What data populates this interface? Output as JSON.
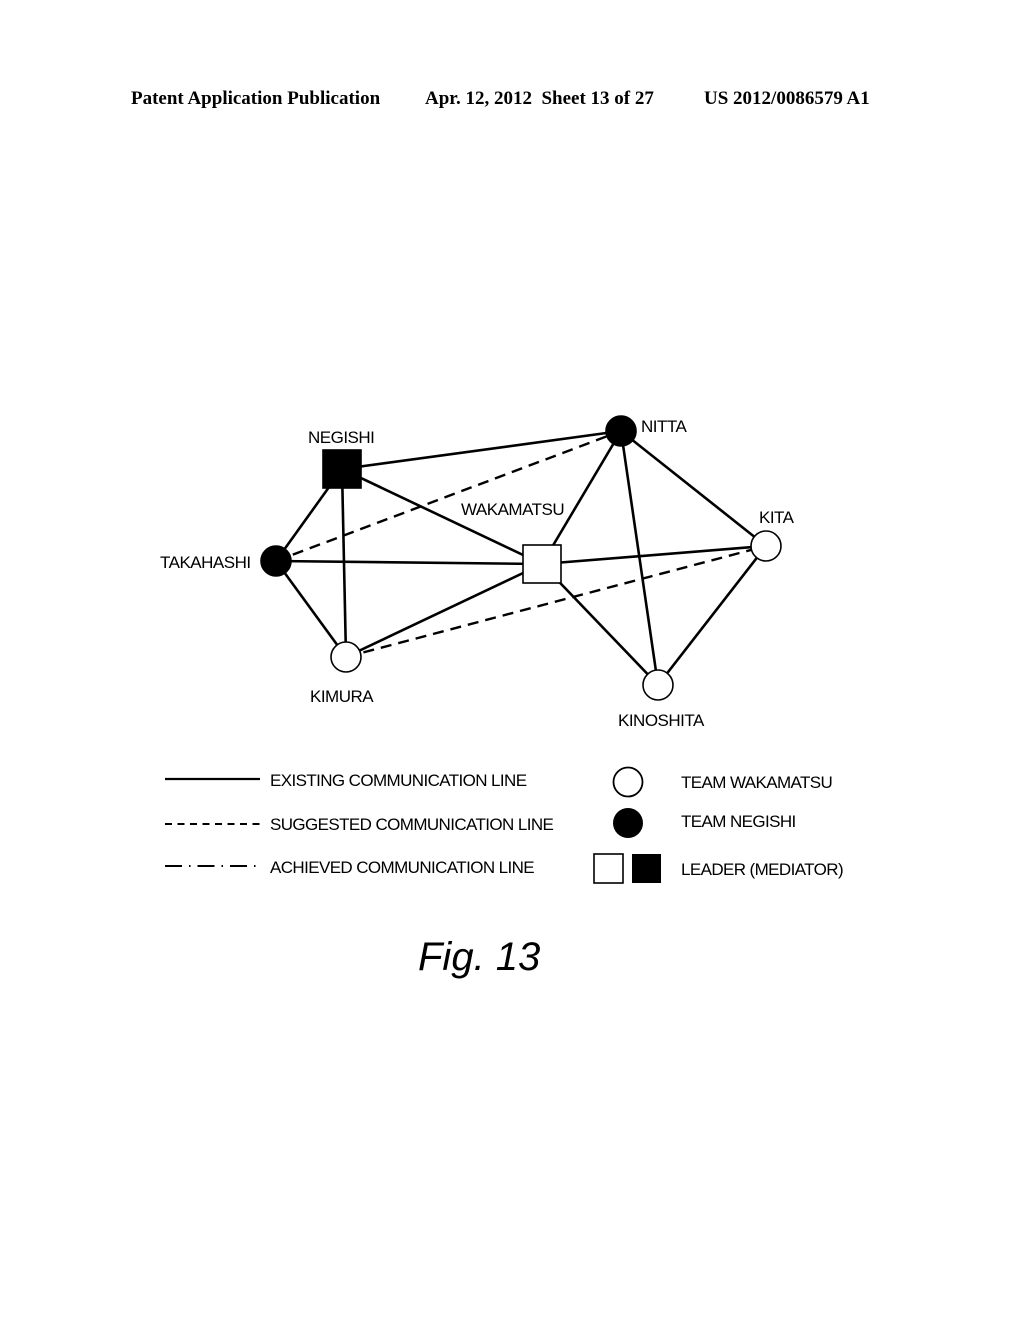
{
  "header": {
    "publication": "Patent Application Publication",
    "date_sheet": "Apr. 12, 2012  Sheet 13 of 27",
    "patent_number": "US 2012/0086579 A1"
  },
  "figure": {
    "caption": "Fig. 13",
    "nodes": [
      {
        "id": "negishi",
        "label": "NEGISHI",
        "team": "negishi",
        "leader": true
      },
      {
        "id": "takahashi",
        "label": "TAKAHASHI",
        "team": "negishi",
        "leader": false
      },
      {
        "id": "kimura",
        "label": "KIMURA",
        "team": "wakamatsu",
        "leader": false
      },
      {
        "id": "wakamatsu",
        "label": "WAKAMATSU",
        "team": "wakamatsu",
        "leader": true
      },
      {
        "id": "nitta",
        "label": "NITTA",
        "team": "negishi",
        "leader": false
      },
      {
        "id": "kita",
        "label": "KITA",
        "team": "wakamatsu",
        "leader": false
      },
      {
        "id": "kinoshita",
        "label": "KINOSHITA",
        "team": "wakamatsu",
        "leader": false
      }
    ],
    "edges": [
      {
        "from": "negishi",
        "to": "nitta",
        "type": "existing"
      },
      {
        "from": "negishi",
        "to": "takahashi",
        "type": "existing"
      },
      {
        "from": "negishi",
        "to": "kimura",
        "type": "existing"
      },
      {
        "from": "negishi",
        "to": "wakamatsu",
        "type": "existing"
      },
      {
        "from": "takahashi",
        "to": "wakamatsu",
        "type": "existing"
      },
      {
        "from": "takahashi",
        "to": "kimura",
        "type": "existing"
      },
      {
        "from": "takahashi",
        "to": "nitta",
        "type": "suggested"
      },
      {
        "from": "kimura",
        "to": "wakamatsu",
        "type": "existing"
      },
      {
        "from": "kimura",
        "to": "kita",
        "type": "suggested"
      },
      {
        "from": "wakamatsu",
        "to": "nitta",
        "type": "existing"
      },
      {
        "from": "wakamatsu",
        "to": "kita",
        "type": "existing"
      },
      {
        "from": "wakamatsu",
        "to": "kinoshita",
        "type": "existing"
      },
      {
        "from": "nitta",
        "to": "kita",
        "type": "existing"
      },
      {
        "from": "nitta",
        "to": "kinoshita",
        "type": "existing"
      },
      {
        "from": "kita",
        "to": "kinoshita",
        "type": "existing"
      }
    ]
  },
  "legend": {
    "lines": [
      {
        "type": "existing",
        "label": "EXISTING COMMUNICATION LINE"
      },
      {
        "type": "suggested",
        "label": "SUGGESTED COMMUNICATION LINE"
      },
      {
        "type": "achieved",
        "label": "ACHIEVED COMMUNICATION LINE"
      }
    ],
    "symbols": [
      {
        "symbol": "white-circle",
        "label": "TEAM WAKAMATSU"
      },
      {
        "symbol": "black-circle",
        "label": "TEAM NEGISHI"
      },
      {
        "symbol": "white-and-black-square",
        "label": "LEADER (MEDIATOR)"
      }
    ]
  },
  "colors": {
    "ink": "#000000",
    "paper": "#ffffff"
  }
}
